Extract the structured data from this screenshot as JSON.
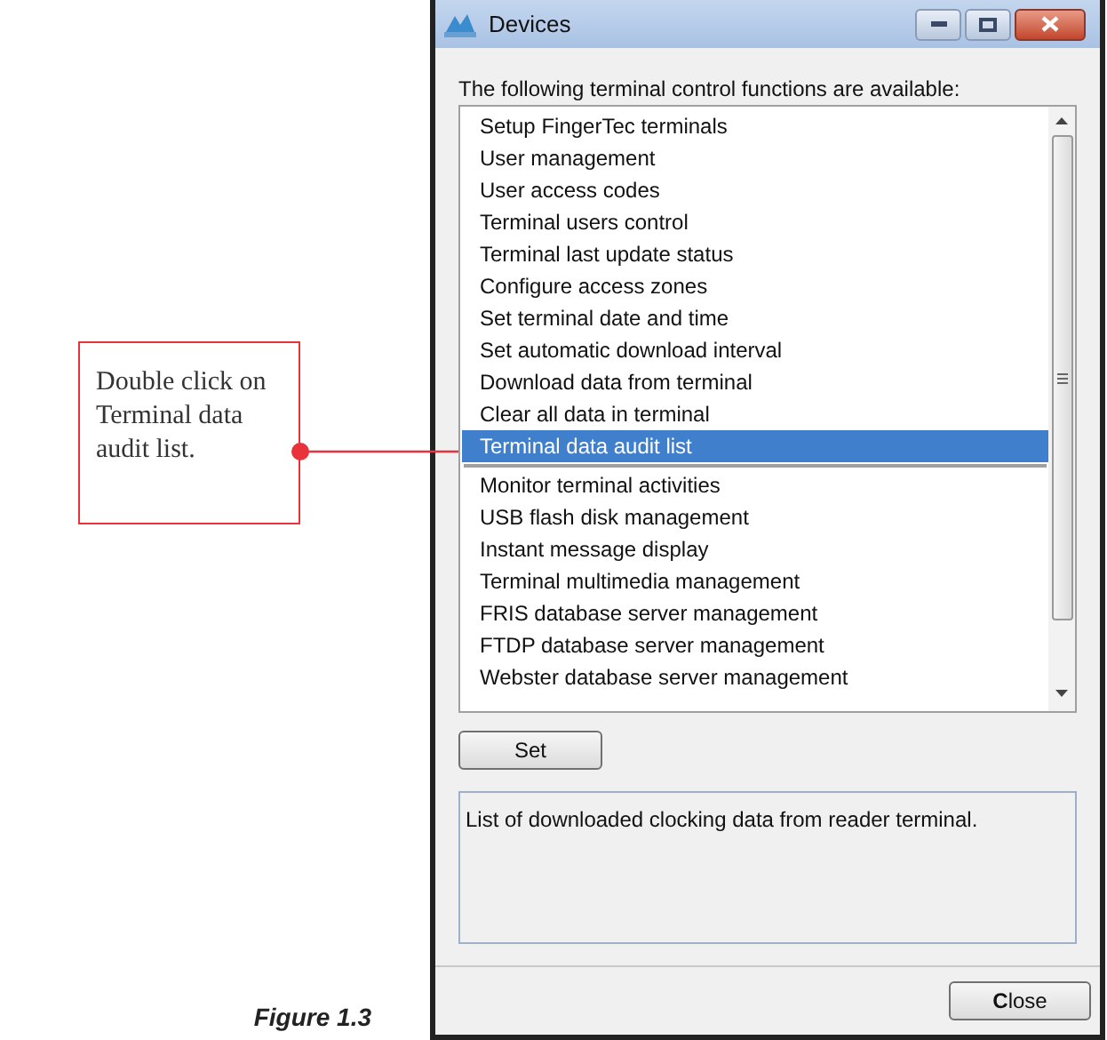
{
  "callout": {
    "text": "Double click on Terminal data audit list."
  },
  "caption": "Figure 1.3",
  "window": {
    "title": "Devices",
    "controls": [
      {
        "kind": "minimize"
      },
      {
        "kind": "maximize"
      },
      {
        "kind": "close"
      }
    ]
  },
  "list_label": "The following terminal control functions are available:",
  "list": [
    {
      "kind": "item",
      "label": "Setup FingerTec terminals",
      "selected": false
    },
    {
      "kind": "item",
      "label": "User management",
      "selected": false
    },
    {
      "kind": "item",
      "label": "User access codes",
      "selected": false
    },
    {
      "kind": "item",
      "label": "Terminal users control",
      "selected": false
    },
    {
      "kind": "item",
      "label": "Terminal last update status",
      "selected": false
    },
    {
      "kind": "item",
      "label": "Configure access zones",
      "selected": false
    },
    {
      "kind": "item",
      "label": "Set terminal date and time",
      "selected": false
    },
    {
      "kind": "item",
      "label": "Set automatic download interval",
      "selected": false
    },
    {
      "kind": "item",
      "label": "Download data from terminal",
      "selected": false
    },
    {
      "kind": "item",
      "label": "Clear all data in terminal",
      "selected": false
    },
    {
      "kind": "item",
      "label": "Terminal data audit list",
      "selected": true
    },
    {
      "kind": "separator"
    },
    {
      "kind": "item",
      "label": "Monitor terminal activities",
      "selected": false
    },
    {
      "kind": "item",
      "label": "USB flash disk management",
      "selected": false
    },
    {
      "kind": "item",
      "label": "Instant message display",
      "selected": false
    },
    {
      "kind": "item",
      "label": "Terminal multimedia management",
      "selected": false
    },
    {
      "kind": "item",
      "label": "FRIS database server management",
      "selected": false
    },
    {
      "kind": "item",
      "label": "FTDP database server management",
      "selected": false
    },
    {
      "kind": "item",
      "label": "Webster database server management",
      "selected": false
    }
  ],
  "set_button": "Set",
  "description": "List of downloaded clocking data from reader terminal.",
  "close_button": "**C**lose"
}
